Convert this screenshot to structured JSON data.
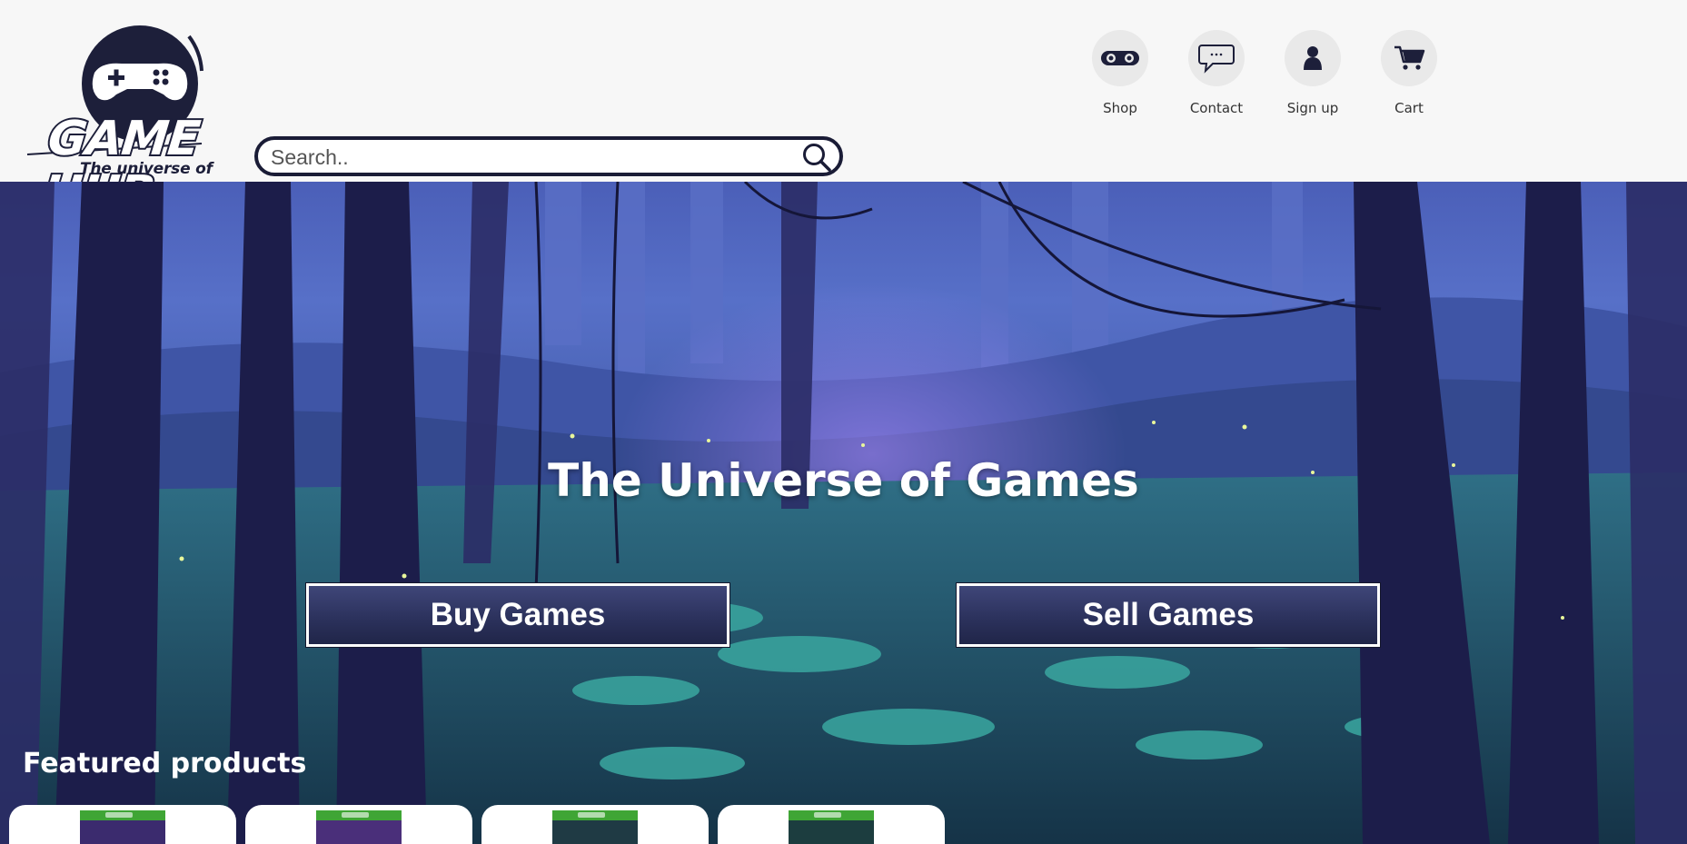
{
  "brand": {
    "name": "GAME HUB",
    "tagline": "The universe of games"
  },
  "search": {
    "placeholder": "Search.."
  },
  "nav": [
    {
      "label": "Shop",
      "icon": "gamepad-icon"
    },
    {
      "label": "Contact",
      "icon": "chat-bubble-icon"
    },
    {
      "label": "Sign up",
      "icon": "user-icon"
    },
    {
      "label": "Cart",
      "icon": "cart-icon"
    }
  ],
  "hero": {
    "title": "The Universe of Games",
    "buy_label": "Buy Games",
    "sell_label": "Sell Games"
  },
  "featured": {
    "heading": "Featured products",
    "cards": [
      {
        "platform_color": "#3fa535",
        "art_color": "#3b2b6e"
      },
      {
        "platform_color": "#3fa535",
        "art_color": "#4a2f7a"
      },
      {
        "platform_color": "#3fa535",
        "art_color": "#1f3a44"
      },
      {
        "platform_color": "#3fa535",
        "art_color": "#1c3d3f"
      }
    ]
  },
  "colors": {
    "header_bg": "#f7f7f7",
    "brand_navy": "#1d1f3a",
    "button_bg": "#2c325d",
    "hero_sky": "#5770c8"
  }
}
